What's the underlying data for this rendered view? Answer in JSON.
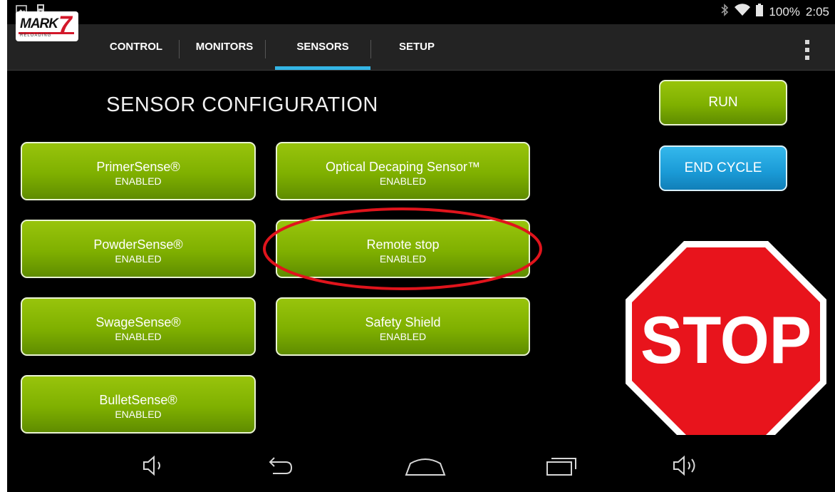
{
  "status_bar": {
    "battery": "100%",
    "time": "2:05"
  },
  "app": {
    "logo_text": "MARK",
    "logo_number": "7",
    "logo_sub": "RELOADING"
  },
  "tabs": [
    {
      "label": "CONTROL",
      "selected": false
    },
    {
      "label": "MONITORS",
      "selected": false
    },
    {
      "label": "SENSORS",
      "selected": true
    },
    {
      "label": "SETUP",
      "selected": false
    }
  ],
  "page": {
    "title": "SENSOR CONFIGURATION"
  },
  "sensors": [
    {
      "name": "PrimerSense®",
      "state": "ENABLED"
    },
    {
      "name": "Optical Decaping Sensor™",
      "state": "ENABLED"
    },
    {
      "name": "PowderSense®",
      "state": "ENABLED"
    },
    {
      "name": "Remote stop",
      "state": "ENABLED"
    },
    {
      "name": "SwageSense®",
      "state": "ENABLED"
    },
    {
      "name": "Safety Shield",
      "state": "ENABLED"
    },
    {
      "name": "BulletSense®",
      "state": "ENABLED"
    }
  ],
  "controls": {
    "run_label": "RUN",
    "end_cycle_label": "END CYCLE",
    "stop_label": "STOP"
  },
  "colors": {
    "button_green": "#7fb000",
    "button_blue": "#1a9ad6",
    "tab_indicator": "#33b5e5",
    "stop_red": "#e8141c",
    "highlight_red": "#e0141c"
  },
  "icons": {
    "status_left": [
      "image-icon",
      "sd-card-icon"
    ],
    "status_right": [
      "bluetooth-icon",
      "wifi-icon",
      "battery-icon"
    ],
    "nav": [
      "volume-down-icon",
      "back-icon",
      "home-icon",
      "recents-icon",
      "volume-up-icon"
    ]
  }
}
